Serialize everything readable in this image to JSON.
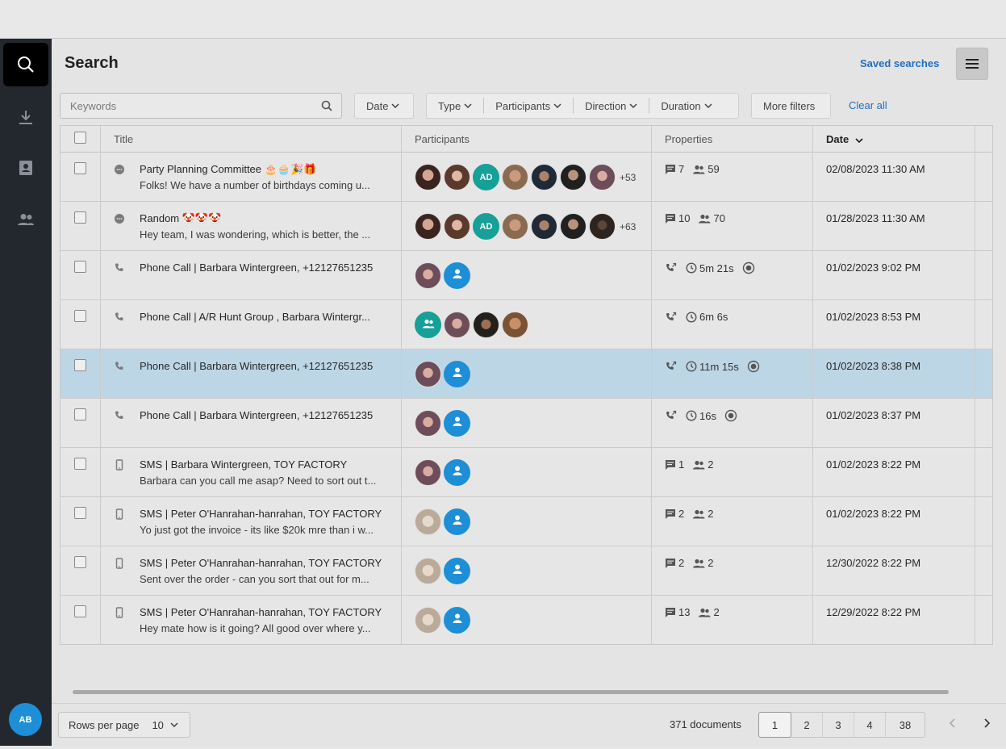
{
  "page": {
    "title": "Search",
    "saved_searches": "Saved searches"
  },
  "search": {
    "placeholder": "Keywords"
  },
  "filters": {
    "date": "Date",
    "type": "Type",
    "participants": "Participants",
    "direction": "Direction",
    "duration": "Duration",
    "more": "More filters",
    "clear_all": "Clear all"
  },
  "columns": {
    "title": "Title",
    "participants": "Participants",
    "properties": "Properties",
    "date": "Date"
  },
  "user": {
    "initials": "AB"
  },
  "rows": [
    {
      "type": "chat",
      "title": "Party Planning Committee 🎂🧁🎉🎁",
      "snippet": "Folks! We have a number of birthdays coming u...",
      "more": "+53",
      "messages": "7",
      "people": "59",
      "date": "02/08/2023 11:30 AM"
    },
    {
      "type": "chat",
      "title": "Random 🤡🤡🤡",
      "snippet": "Hey team, I was wondering, which is better, the ...",
      "more": "+63",
      "messages": "10",
      "people": "70",
      "date": "01/28/2023 11:30 AM"
    },
    {
      "type": "phone",
      "title": "Phone Call | Barbara Wintergreen, +12127651235",
      "snippet": "",
      "duration": "5m 21s",
      "date": "01/02/2023 9:02 PM"
    },
    {
      "type": "phone",
      "title": "Phone Call | A/R Hunt Group , Barbara Wintergr...",
      "snippet": "",
      "duration": "6m 6s",
      "date": "01/02/2023 8:53 PM"
    },
    {
      "type": "phone",
      "title": "Phone Call | Barbara Wintergreen, +12127651235",
      "snippet": "",
      "duration": "11m 15s",
      "date": "01/02/2023 8:38 PM"
    },
    {
      "type": "phone",
      "title": "Phone Call | Barbara Wintergreen, +12127651235",
      "snippet": "",
      "duration": "16s",
      "date": "01/02/2023 8:37 PM"
    },
    {
      "type": "sms",
      "title": "SMS | Barbara Wintergreen, TOY FACTORY",
      "snippet": "Barbara can you call me asap? Need to sort out t...",
      "messages": "1",
      "people": "2",
      "date": "01/02/2023 8:22 PM"
    },
    {
      "type": "sms",
      "title": "SMS | Peter O'Hanrahan-hanrahan, TOY FACTORY",
      "snippet": "Yo just got the invoice - its like $20k mre than i w...",
      "messages": "2",
      "people": "2",
      "date": "01/02/2023 8:22 PM"
    },
    {
      "type": "sms",
      "title": "SMS | Peter O'Hanrahan-hanrahan, TOY FACTORY",
      "snippet": "Sent over the order - can you sort that out for m...",
      "messages": "2",
      "people": "2",
      "date": "12/30/2022 8:22 PM"
    },
    {
      "type": "sms",
      "title": "SMS | Peter O'Hanrahan-hanrahan, TOY FACTORY",
      "snippet": "Hey mate how is it going? All good over where y...",
      "messages": "13",
      "people": "2",
      "date": "12/29/2022 8:22 PM"
    }
  ],
  "avatar_initials": "AD",
  "footer": {
    "rows_per_page_label": "Rows per page",
    "rows_per_page_value": "10",
    "documents": "371 documents",
    "pages": [
      "1",
      "2",
      "3",
      "4",
      "38"
    ]
  }
}
